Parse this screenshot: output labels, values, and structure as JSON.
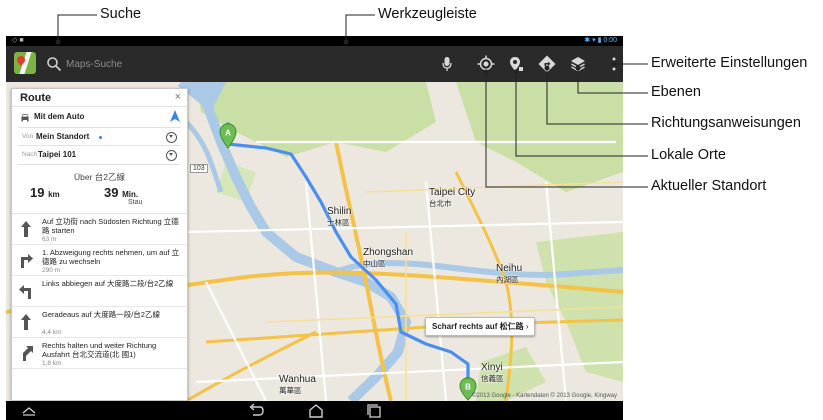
{
  "callouts": {
    "search": "Suche",
    "toolbar": "Werkzeugleiste",
    "advanced_settings": "Erweiterte Einstellungen",
    "layers": "Ebenen",
    "directions": "Richtungsanweisungen",
    "local_places": "Lokale Orte",
    "current_location": "Aktueller Standort"
  },
  "statusbar": {
    "left": "◇ ■",
    "right": "✱ ▾ ▮ 0:00"
  },
  "search": {
    "placeholder": "Maps-Suche"
  },
  "toolbar_icons": [
    "microphone-icon",
    "my-location-icon",
    "local-places-icon",
    "directions-icon",
    "layers-icon",
    "overflow-menu-icon"
  ],
  "route_panel": {
    "title": "Route",
    "close": "×",
    "mode": "Mit dem Auto",
    "from_label": "Von",
    "from_value": "Mein Standort",
    "to_label": "Nach",
    "to_value": "Taipei 101",
    "via": "Über 台2乙線",
    "distance_value": "19",
    "distance_unit": "km",
    "duration_value": "39",
    "duration_unit": "Min.",
    "duration_note": "Stau",
    "steps": [
      {
        "icon": "arrow-up-icon",
        "text": "Auf 立功街 nach Südosten Richtung 立德路 starten",
        "distance": "63 m"
      },
      {
        "icon": "turn-right-icon",
        "text": "1. Abzweigung rechts nehmen, um auf 立德路 zu wechseln",
        "distance": "290 m"
      },
      {
        "icon": "turn-left-icon",
        "text": "Links abbiegen auf 大度路二段/台2乙線",
        "distance": ""
      },
      {
        "icon": "arrow-up-icon",
        "text": "Geradeaus auf 大度路一段/台2乙線",
        "distance": "4,4 km"
      },
      {
        "icon": "keep-right-icon",
        "text": "Rechts halten und weiter Richtung Ausfahrt 台北交流道(北 國1)",
        "distance": "1,8 km"
      }
    ]
  },
  "map_labels": {
    "shilin": "Shilin",
    "shilin_sub": "士林區",
    "taipei_city": "Taipei City",
    "taipei_city_sub": "台北市",
    "zhongshan": "Zhongshan",
    "zhongshan_sub": "中山區",
    "neihu": "Neihu",
    "neihu_sub": "內湖區",
    "xinyi": "Xinyi",
    "xinyi_sub": "信義區",
    "wanhua": "Wanhua",
    "wanhua_sub": "萬華區",
    "marker_a": "A",
    "marker_b": "B",
    "road_103": "103"
  },
  "turn_bubble": {
    "bold": "Scharf rechts auf 松仁路",
    "arrow": "›"
  },
  "copyright": "©2013 Google - Kartendaten © 2013 Google, Kingway",
  "navbar_icons": [
    "collapse-icon",
    "back-icon",
    "home-icon",
    "recent-apps-icon"
  ],
  "colors": {
    "route": "#4a8ff0",
    "statusbar_accent": "#5ab4ff",
    "actionbar": "#2a2a2a",
    "park": "#c9dfa5",
    "water": "#a9c9e6",
    "highway": "#f3c247"
  }
}
